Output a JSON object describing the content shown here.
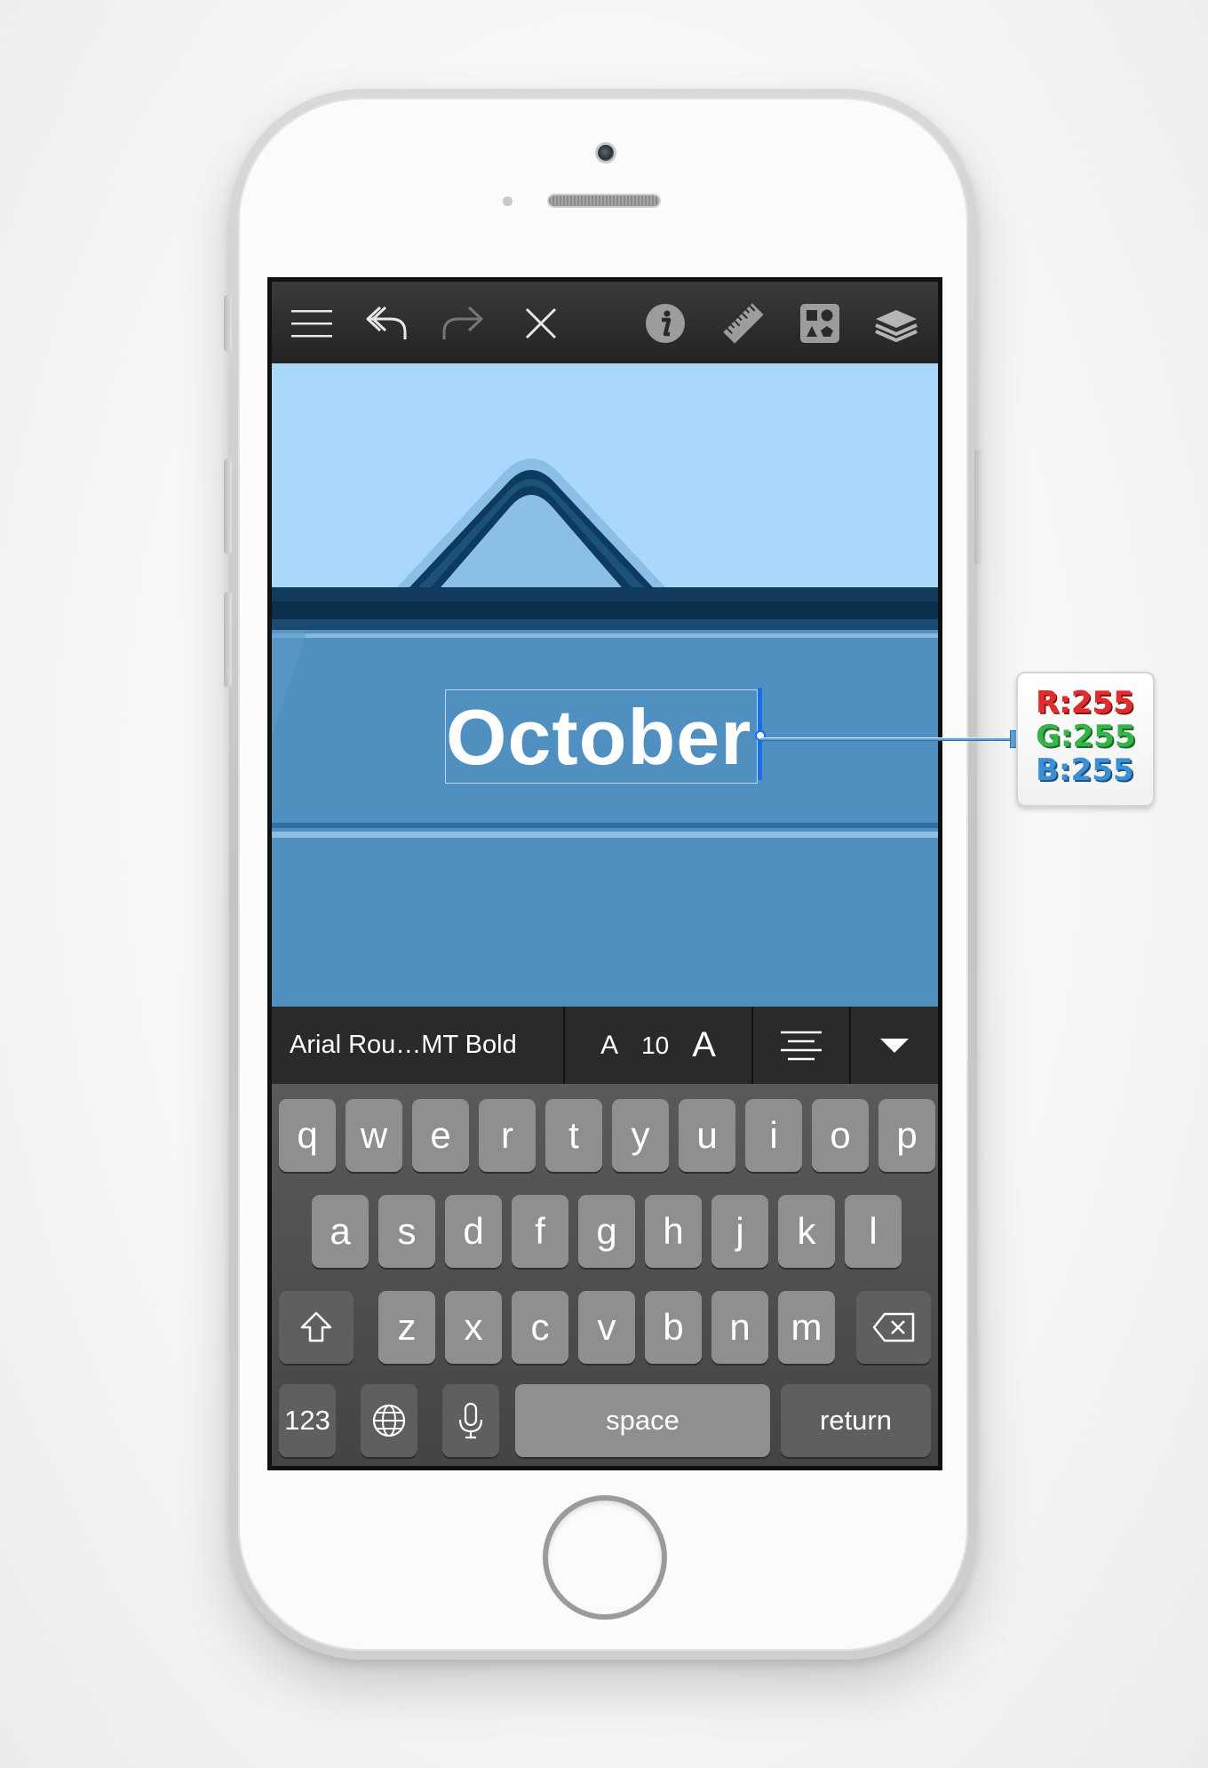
{
  "toolbar": {
    "buttons": [
      {
        "name": "menu",
        "icon": "hamburger-icon"
      },
      {
        "name": "undo",
        "icon": "undo-icon"
      },
      {
        "name": "redo",
        "icon": "redo-icon"
      },
      {
        "name": "close",
        "icon": "close-icon"
      },
      {
        "name": "info",
        "icon": "info-icon"
      },
      {
        "name": "ruler",
        "icon": "ruler-icon"
      },
      {
        "name": "shapes",
        "icon": "shapes-icon"
      },
      {
        "name": "layers",
        "icon": "layers-icon"
      }
    ]
  },
  "canvas": {
    "text": "October",
    "colors": {
      "sky": "#aad8fa",
      "band": "#5090c0",
      "dark": "#123a5c"
    }
  },
  "font_bar": {
    "font_name": "Arial Rou…MT Bold",
    "size_small_glyph": "A",
    "size_value": "10",
    "size_large_glyph": "A"
  },
  "keyboard": {
    "row1": [
      "q",
      "w",
      "e",
      "r",
      "t",
      "y",
      "u",
      "i",
      "o",
      "p"
    ],
    "row2": [
      "a",
      "s",
      "d",
      "f",
      "g",
      "h",
      "j",
      "k",
      "l"
    ],
    "row3": [
      "z",
      "x",
      "c",
      "v",
      "b",
      "n",
      "m"
    ],
    "numbers_label": "123",
    "space_label": "space",
    "return_label": "return"
  },
  "color_tag": {
    "r": "R:255",
    "g": "G:255",
    "b": "B:255"
  }
}
